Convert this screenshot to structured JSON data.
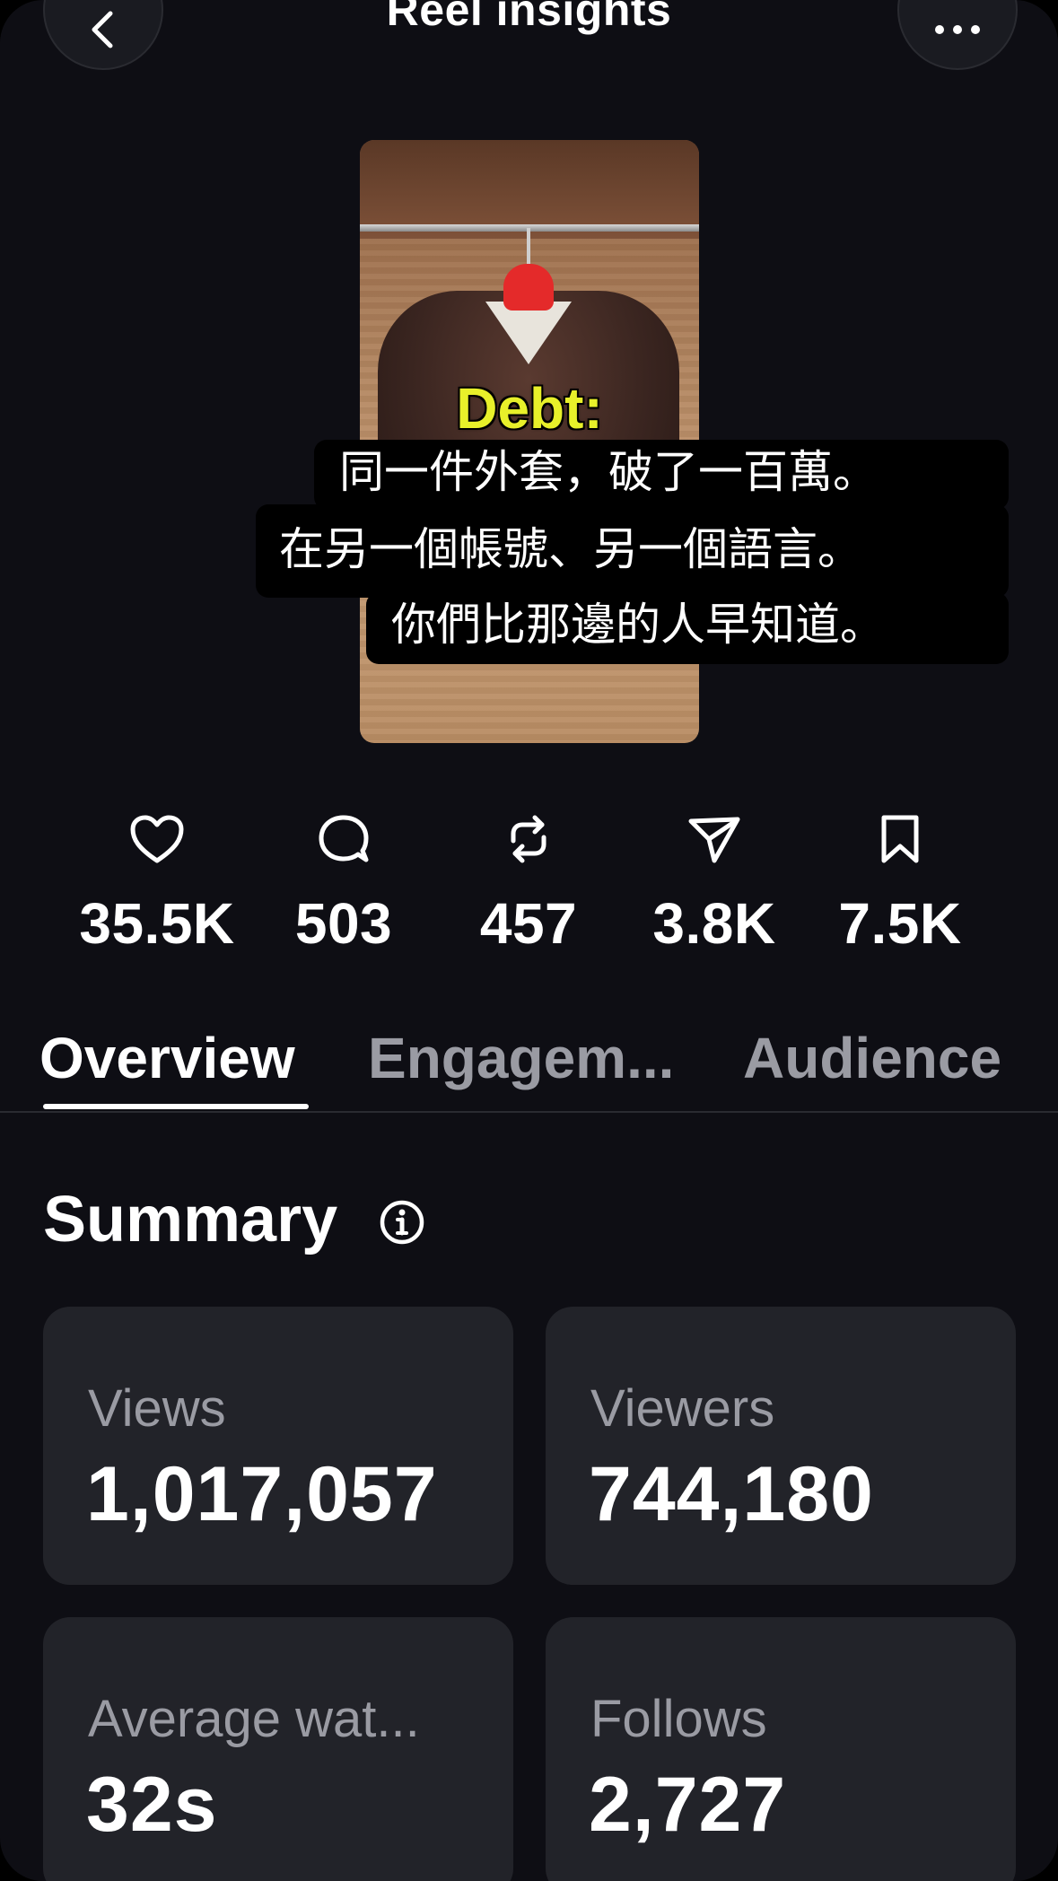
{
  "header": {
    "title": "Reel insights"
  },
  "reel": {
    "thumbnail_text": "Debt:",
    "caption_lines": [
      "同一件外套，破了一百萬。",
      "在另一個帳號、另一個語言。",
      "你們比那邊的人早知道。"
    ]
  },
  "stats": [
    {
      "icon": "heart-icon",
      "value": "35.5K"
    },
    {
      "icon": "comment-icon",
      "value": "503"
    },
    {
      "icon": "repost-icon",
      "value": "457"
    },
    {
      "icon": "share-icon",
      "value": "3.8K"
    },
    {
      "icon": "bookmark-icon",
      "value": "7.5K"
    }
  ],
  "tabs": [
    {
      "label": "Overview",
      "active": true
    },
    {
      "label": "Engagem...",
      "active": false
    },
    {
      "label": "Audience",
      "active": false
    }
  ],
  "summary": {
    "title": "Summary",
    "cards": [
      {
        "label": "Views",
        "value": "1,017,057"
      },
      {
        "label": "Viewers",
        "value": "744,180"
      },
      {
        "label": "Average wat...",
        "value": "32s"
      },
      {
        "label": "Follows",
        "value": "2,727"
      }
    ]
  },
  "colors": {
    "background": "#0e0e14",
    "card": "#222329",
    "muted_text": "#9a9ba3",
    "accent_caption": "#e8f02a"
  }
}
